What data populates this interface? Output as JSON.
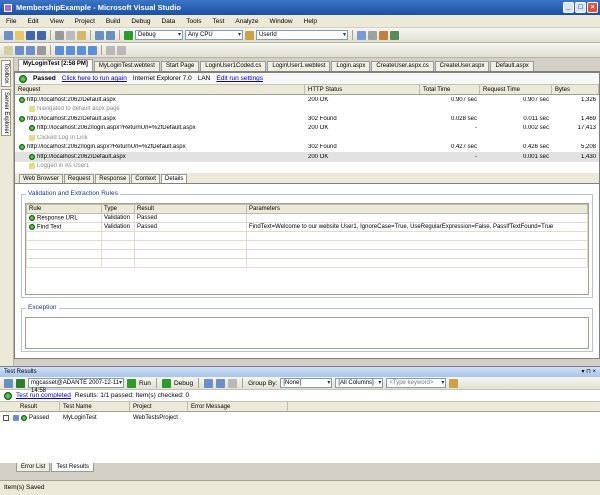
{
  "window": {
    "title": "MembershipExample - Microsoft Visual Studio"
  },
  "menu": [
    "File",
    "Edit",
    "View",
    "Project",
    "Build",
    "Debug",
    "Data",
    "Tools",
    "Test",
    "Analyze",
    "Window",
    "Help"
  ],
  "toolbar": {
    "config": "Debug",
    "platform": "Any CPU",
    "find": "UserId"
  },
  "left_dock": [
    "Toolbox",
    "Server Explorer"
  ],
  "doc_tabs": [
    "MyLoginTest [2:58 PM]",
    "MyLoginTest.webtest",
    "Start Page",
    "LoginUser1Coded.cs",
    "LoginUser1.webtest",
    "Login.aspx",
    "CreateUser.aspx.cs",
    "CreateUser.aspx",
    "Default.aspx"
  ],
  "run_status": {
    "result": "Passed",
    "rerun_link": "Click here to run again",
    "browser": "Internet Explorer 7.0",
    "connection": "LAN",
    "edit_link": "Edit run settings"
  },
  "request_grid": {
    "headers": [
      "Request",
      "HTTP Status",
      "Total Time",
      "Request Time",
      "Bytes"
    ],
    "rows": [
      {
        "request": "http://localhost:2062/Default.aspx",
        "status": "200 OK",
        "total": "0.907 sec",
        "req": "0.907 sec",
        "bytes": "1,326",
        "indent": 0
      },
      {
        "request": "Navigated to default aspx page",
        "status": "",
        "total": "",
        "req": "",
        "bytes": "",
        "indent": 1
      },
      {
        "request": "http://localhost:2062/Default.aspx",
        "status": "302 Found",
        "total": "0.028 sec",
        "req": "0.011 sec",
        "bytes": "1,469",
        "indent": 0
      },
      {
        "request": "http://localhost:2062/login.aspx?ReturnUrl=%2fDefault.aspx",
        "status": "200 OK",
        "total": "-",
        "req": "0.002 sec",
        "bytes": "17,413",
        "indent": 1
      },
      {
        "request": "Clicked Log In Link",
        "status": "",
        "total": "",
        "req": "",
        "bytes": "",
        "indent": 1
      },
      {
        "request": "http://localhost:2062/login.aspx?ReturnUrl=%2fDefault.aspx",
        "status": "302 Found",
        "total": "0.427 sec",
        "req": "0.426 sec",
        "bytes": "5,208",
        "indent": 0
      },
      {
        "request": "http://localhost:2062/Default.aspx",
        "status": "200 OK",
        "total": "-",
        "req": "0.001 sec",
        "bytes": "1,430",
        "indent": 1
      },
      {
        "request": "Logged in As User1",
        "status": "",
        "total": "",
        "req": "",
        "bytes": "",
        "indent": 1
      }
    ]
  },
  "sub_tabs": [
    "Web Browser",
    "Request",
    "Response",
    "Context",
    "Details"
  ],
  "validation": {
    "title": "Validation and Extraction Rules",
    "headers": [
      "Rule",
      "Type",
      "Result",
      "Parameters"
    ],
    "rows": [
      {
        "rule": "Response URL",
        "type": "Validation",
        "result": "Passed",
        "params": ""
      },
      {
        "rule": "Find Text",
        "type": "Validation",
        "result": "Passed",
        "params": "FindText=Welcome to our website User1, IgnoreCase=True, UseRegularExpression=False, PassIfTextFound=True"
      }
    ]
  },
  "exception": {
    "title": "Exception"
  },
  "test_results": {
    "title": "Test Results",
    "run_name": "mgcasset@ADANTE 2007-12-11 14:58",
    "run_btn": "Run",
    "debug_btn": "Debug",
    "group_by_label": "Group By:",
    "group_by_value": "[None]",
    "columns_value": "[All Columns]",
    "search_placeholder": "<Type keyword>",
    "summary_link": "Test run completed",
    "summary_text": "Results: 1/1 passed; Item(s) checked: 0",
    "headers": [
      "Result",
      "Test Name",
      "Project",
      "Error Message"
    ],
    "rows": [
      {
        "result": "Passed",
        "name": "MyLoginTest",
        "project": "WebTestsProject",
        "error": ""
      }
    ]
  },
  "bottom_tabs": [
    "Error List",
    "Test Results"
  ],
  "statusbar": "Item(s) Saved"
}
